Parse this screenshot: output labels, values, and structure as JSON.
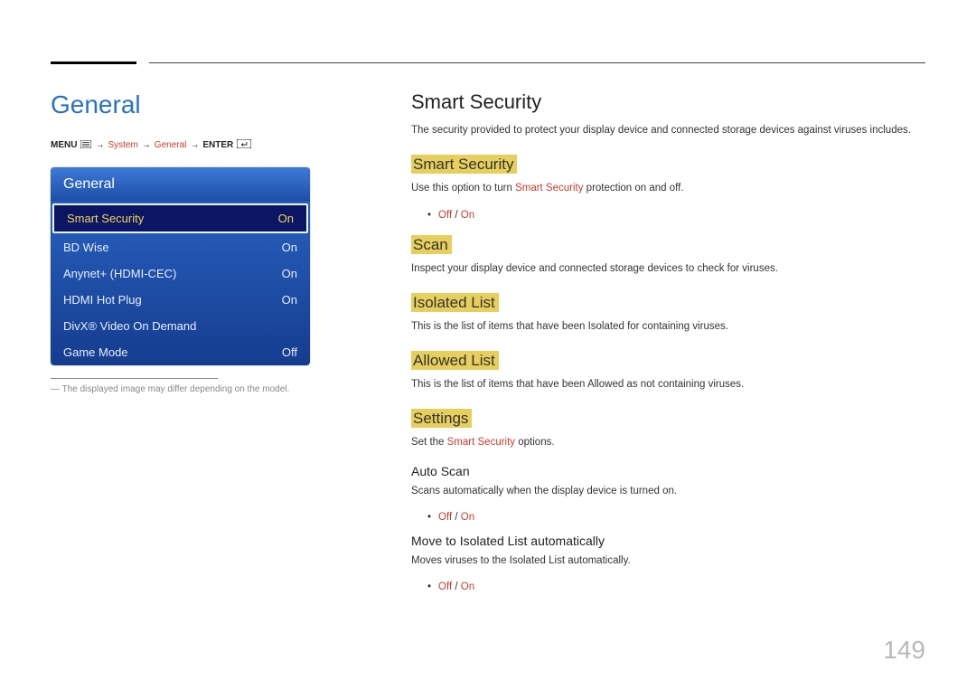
{
  "page_number": "149",
  "left": {
    "title": "General",
    "breadcrumb": {
      "menu": "MENU",
      "arrow": "→",
      "system": "System",
      "general": "General",
      "enter": "ENTER"
    },
    "panel_title": "General",
    "menu": [
      {
        "label": "Smart Security",
        "value": "On",
        "selected": true
      },
      {
        "label": "BD Wise",
        "value": "On",
        "selected": false
      },
      {
        "label": "Anynet+ (HDMI-CEC)",
        "value": "On",
        "selected": false
      },
      {
        "label": "HDMI Hot Plug",
        "value": "On",
        "selected": false
      },
      {
        "label": "DivX® Video On Demand",
        "value": "",
        "selected": false
      },
      {
        "label": "Game Mode",
        "value": "Off",
        "selected": false
      }
    ],
    "footnote_prefix": "―",
    "footnote": "The displayed image may differ depending on the model."
  },
  "right": {
    "title": "Smart Security",
    "intro": "The security provided to protect your display device and connected storage devices against viruses includes.",
    "sections": [
      {
        "heading": "Smart Security",
        "text_pre": "Use this option to turn ",
        "text_red": "Smart Security",
        "text_post": " protection on and off.",
        "options": "Off / On"
      },
      {
        "heading": "Scan",
        "text": "Inspect your display device and connected storage devices to check for viruses."
      },
      {
        "heading": "Isolated List",
        "text": "This is the list of items that have been Isolated for containing viruses."
      },
      {
        "heading": "Allowed List",
        "text": "This is the list of items that have been Allowed as not containing viruses."
      },
      {
        "heading": "Settings",
        "text_pre": "Set the ",
        "text_red": "Smart Security",
        "text_post": " options.",
        "subs": [
          {
            "sub_heading": "Auto Scan",
            "text": "Scans automatically when the display device is turned on.",
            "options": "Off / On"
          },
          {
            "sub_heading": "Move to Isolated List automatically",
            "text": "Moves viruses to the Isolated List automatically.",
            "options": "Off / On"
          }
        ]
      }
    ]
  }
}
